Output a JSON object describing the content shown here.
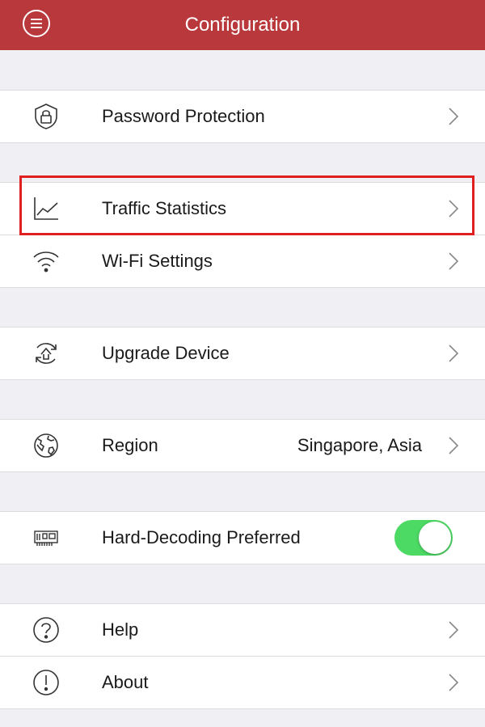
{
  "header": {
    "title": "Configuration",
    "menu_icon": "menu-icon"
  },
  "groups": [
    {
      "items": [
        {
          "label": "Password Protection",
          "icon": "lock-shield-icon"
        }
      ]
    },
    {
      "items": [
        {
          "label": "Traffic Statistics",
          "icon": "line-chart-icon"
        },
        {
          "label": "Wi-Fi Settings",
          "icon": "wifi-icon"
        }
      ]
    },
    {
      "items": [
        {
          "label": "Upgrade Device",
          "icon": "upgrade-icon"
        }
      ]
    },
    {
      "items": [
        {
          "label": "Region",
          "value": "Singapore, Asia",
          "icon": "globe-icon"
        }
      ]
    },
    {
      "items": [
        {
          "label": "Hard-Decoding Preferred",
          "icon": "decoder-card-icon",
          "toggle_on": true
        }
      ]
    },
    {
      "items": [
        {
          "label": "Help",
          "icon": "help-icon"
        },
        {
          "label": "About",
          "icon": "info-icon"
        }
      ]
    }
  ],
  "colors": {
    "header": "#b8383b",
    "toggle_on": "#4cd964",
    "highlight": "#e02020"
  }
}
